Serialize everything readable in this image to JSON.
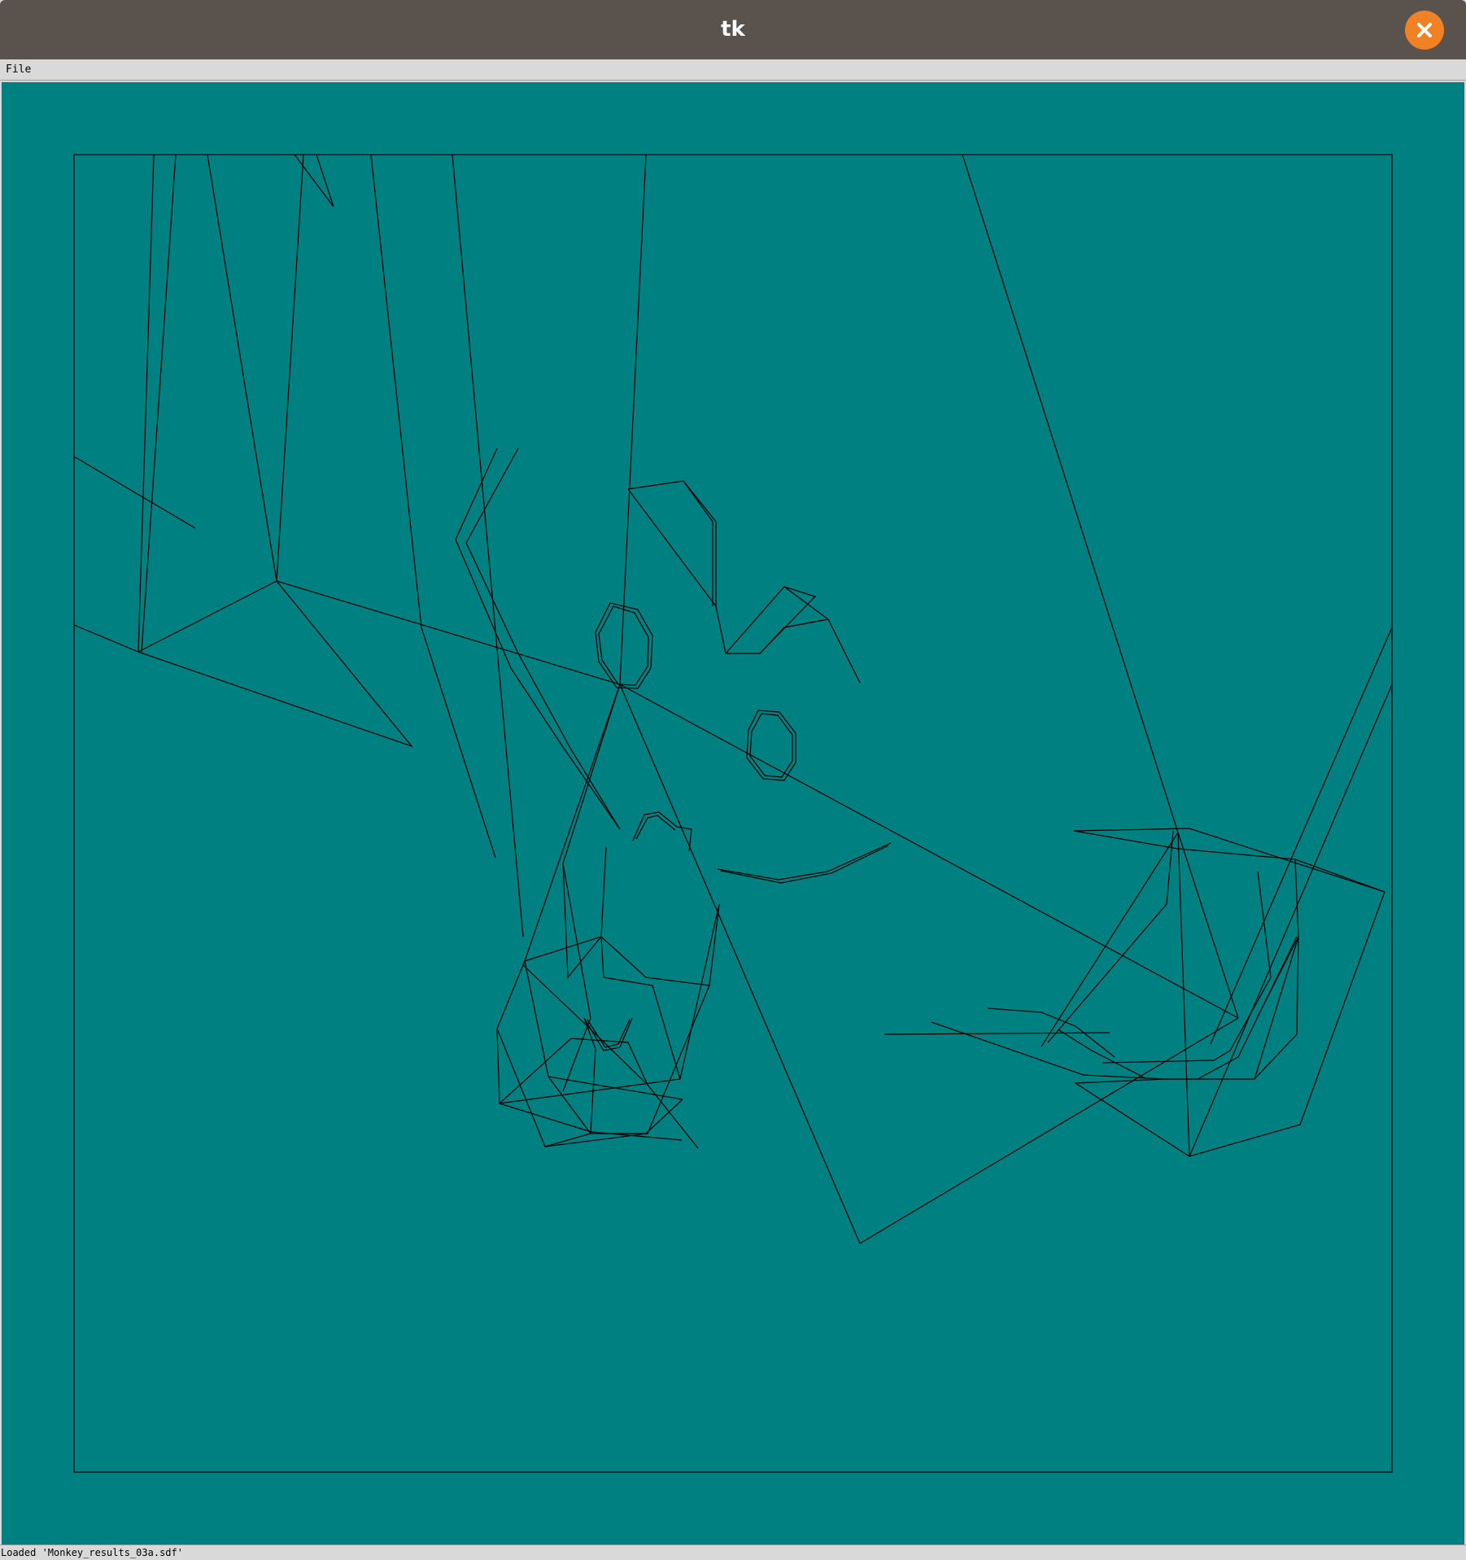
{
  "window": {
    "title": "tk",
    "close_icon": "close-icon",
    "close_color": "#f08124"
  },
  "menu": {
    "items": [
      {
        "label": "File"
      }
    ]
  },
  "canvas": {
    "background_color": "#008080",
    "line_color": "#000000",
    "content": "wireframe-mesh"
  },
  "status": {
    "text": "Loaded 'Monkey_results_03a.sdf'"
  }
}
